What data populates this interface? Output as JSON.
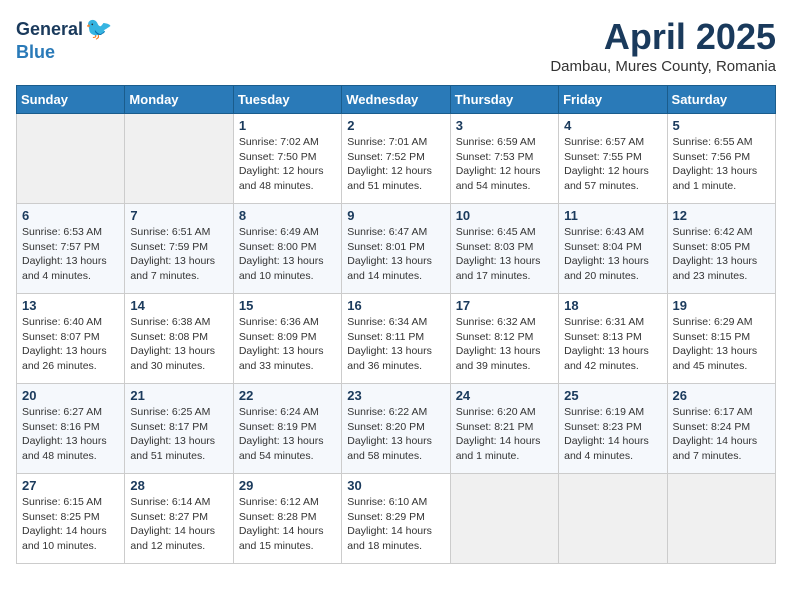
{
  "logo": {
    "general": "General",
    "blue": "Blue"
  },
  "title": "April 2025",
  "location": "Dambau, Mures County, Romania",
  "days_of_week": [
    "Sunday",
    "Monday",
    "Tuesday",
    "Wednesday",
    "Thursday",
    "Friday",
    "Saturday"
  ],
  "weeks": [
    [
      {
        "day": "",
        "info": ""
      },
      {
        "day": "",
        "info": ""
      },
      {
        "day": "1",
        "info": "Sunrise: 7:02 AM\nSunset: 7:50 PM\nDaylight: 12 hours and 48 minutes."
      },
      {
        "day": "2",
        "info": "Sunrise: 7:01 AM\nSunset: 7:52 PM\nDaylight: 12 hours and 51 minutes."
      },
      {
        "day": "3",
        "info": "Sunrise: 6:59 AM\nSunset: 7:53 PM\nDaylight: 12 hours and 54 minutes."
      },
      {
        "day": "4",
        "info": "Sunrise: 6:57 AM\nSunset: 7:55 PM\nDaylight: 12 hours and 57 minutes."
      },
      {
        "day": "5",
        "info": "Sunrise: 6:55 AM\nSunset: 7:56 PM\nDaylight: 13 hours and 1 minute."
      }
    ],
    [
      {
        "day": "6",
        "info": "Sunrise: 6:53 AM\nSunset: 7:57 PM\nDaylight: 13 hours and 4 minutes."
      },
      {
        "day": "7",
        "info": "Sunrise: 6:51 AM\nSunset: 7:59 PM\nDaylight: 13 hours and 7 minutes."
      },
      {
        "day": "8",
        "info": "Sunrise: 6:49 AM\nSunset: 8:00 PM\nDaylight: 13 hours and 10 minutes."
      },
      {
        "day": "9",
        "info": "Sunrise: 6:47 AM\nSunset: 8:01 PM\nDaylight: 13 hours and 14 minutes."
      },
      {
        "day": "10",
        "info": "Sunrise: 6:45 AM\nSunset: 8:03 PM\nDaylight: 13 hours and 17 minutes."
      },
      {
        "day": "11",
        "info": "Sunrise: 6:43 AM\nSunset: 8:04 PM\nDaylight: 13 hours and 20 minutes."
      },
      {
        "day": "12",
        "info": "Sunrise: 6:42 AM\nSunset: 8:05 PM\nDaylight: 13 hours and 23 minutes."
      }
    ],
    [
      {
        "day": "13",
        "info": "Sunrise: 6:40 AM\nSunset: 8:07 PM\nDaylight: 13 hours and 26 minutes."
      },
      {
        "day": "14",
        "info": "Sunrise: 6:38 AM\nSunset: 8:08 PM\nDaylight: 13 hours and 30 minutes."
      },
      {
        "day": "15",
        "info": "Sunrise: 6:36 AM\nSunset: 8:09 PM\nDaylight: 13 hours and 33 minutes."
      },
      {
        "day": "16",
        "info": "Sunrise: 6:34 AM\nSunset: 8:11 PM\nDaylight: 13 hours and 36 minutes."
      },
      {
        "day": "17",
        "info": "Sunrise: 6:32 AM\nSunset: 8:12 PM\nDaylight: 13 hours and 39 minutes."
      },
      {
        "day": "18",
        "info": "Sunrise: 6:31 AM\nSunset: 8:13 PM\nDaylight: 13 hours and 42 minutes."
      },
      {
        "day": "19",
        "info": "Sunrise: 6:29 AM\nSunset: 8:15 PM\nDaylight: 13 hours and 45 minutes."
      }
    ],
    [
      {
        "day": "20",
        "info": "Sunrise: 6:27 AM\nSunset: 8:16 PM\nDaylight: 13 hours and 48 minutes."
      },
      {
        "day": "21",
        "info": "Sunrise: 6:25 AM\nSunset: 8:17 PM\nDaylight: 13 hours and 51 minutes."
      },
      {
        "day": "22",
        "info": "Sunrise: 6:24 AM\nSunset: 8:19 PM\nDaylight: 13 hours and 54 minutes."
      },
      {
        "day": "23",
        "info": "Sunrise: 6:22 AM\nSunset: 8:20 PM\nDaylight: 13 hours and 58 minutes."
      },
      {
        "day": "24",
        "info": "Sunrise: 6:20 AM\nSunset: 8:21 PM\nDaylight: 14 hours and 1 minute."
      },
      {
        "day": "25",
        "info": "Sunrise: 6:19 AM\nSunset: 8:23 PM\nDaylight: 14 hours and 4 minutes."
      },
      {
        "day": "26",
        "info": "Sunrise: 6:17 AM\nSunset: 8:24 PM\nDaylight: 14 hours and 7 minutes."
      }
    ],
    [
      {
        "day": "27",
        "info": "Sunrise: 6:15 AM\nSunset: 8:25 PM\nDaylight: 14 hours and 10 minutes."
      },
      {
        "day": "28",
        "info": "Sunrise: 6:14 AM\nSunset: 8:27 PM\nDaylight: 14 hours and 12 minutes."
      },
      {
        "day": "29",
        "info": "Sunrise: 6:12 AM\nSunset: 8:28 PM\nDaylight: 14 hours and 15 minutes."
      },
      {
        "day": "30",
        "info": "Sunrise: 6:10 AM\nSunset: 8:29 PM\nDaylight: 14 hours and 18 minutes."
      },
      {
        "day": "",
        "info": ""
      },
      {
        "day": "",
        "info": ""
      },
      {
        "day": "",
        "info": ""
      }
    ]
  ]
}
